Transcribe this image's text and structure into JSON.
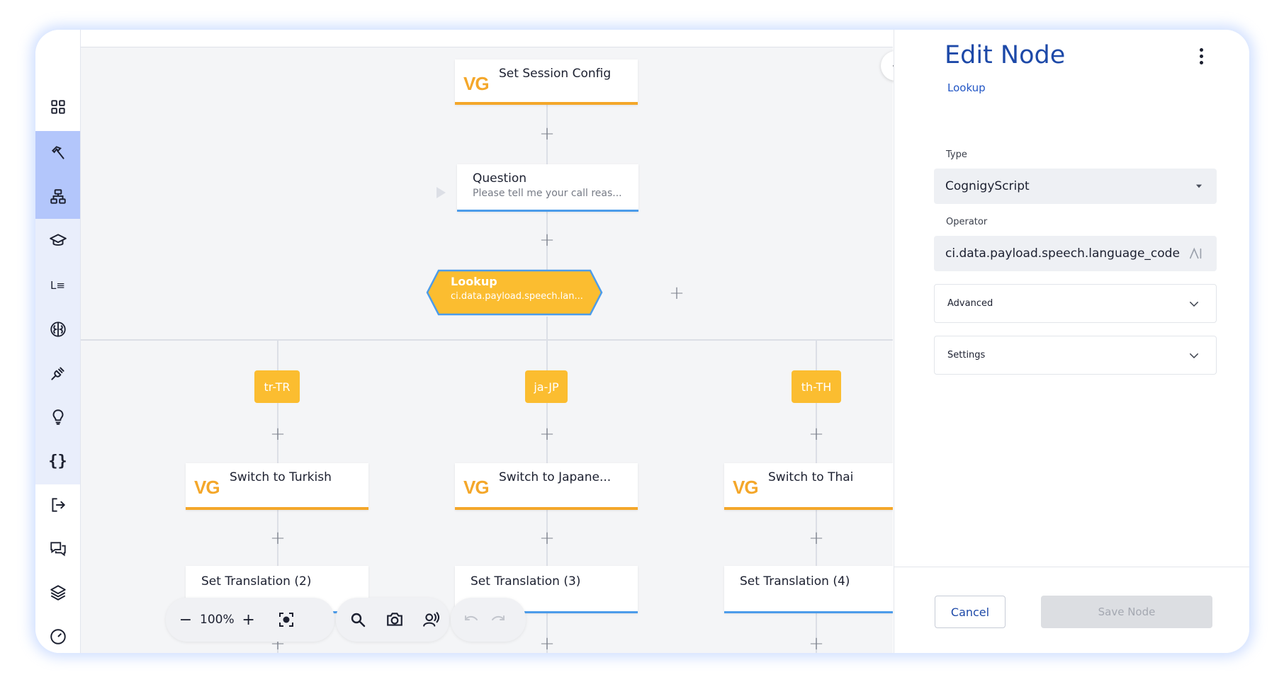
{
  "sidebar": {
    "items": [
      {
        "icon": "grid-icon"
      },
      {
        "icon": "hammer-icon"
      },
      {
        "icon": "flow-icon"
      },
      {
        "icon": "graduation-cap-icon"
      },
      {
        "icon": "lexicon-icon",
        "glyph": "L≡"
      },
      {
        "icon": "brain-icon"
      },
      {
        "icon": "plug-icon"
      },
      {
        "icon": "lightbulb-icon"
      },
      {
        "icon": "code-braces-icon",
        "glyph": "{}"
      },
      {
        "icon": "logout-icon"
      },
      {
        "icon": "chat-icon"
      },
      {
        "icon": "layers-icon"
      },
      {
        "icon": "gauge-icon"
      }
    ]
  },
  "canvas": {
    "nodes": {
      "session_config": {
        "logo": "VG",
        "title": "Set Session Config"
      },
      "question": {
        "title": "Question",
        "subtitle": "Please tell me your call reas..."
      },
      "lookup": {
        "title": "Lookup",
        "subtitle": "ci.data.payload.speech.lan..."
      },
      "case_tr": {
        "label": "tr-TR"
      },
      "case_ja": {
        "label": "ja-JP"
      },
      "case_th": {
        "label": "th-TH"
      },
      "switch_tr": {
        "logo": "VG",
        "title": "Switch to Turkish"
      },
      "switch_ja": {
        "logo": "VG",
        "title": "Switch to Japane..."
      },
      "switch_th": {
        "logo": "VG",
        "title": "Switch to Thai"
      },
      "translation_2": {
        "title": "Set Translation (2)"
      },
      "translation_3": {
        "title": "Set Translation (3)"
      },
      "translation_4": {
        "title": "Set Translation (4)"
      }
    },
    "add_glyph": "+",
    "toolbar": {
      "zoom_out": "−",
      "zoom_level": "100%",
      "zoom_in": "+"
    },
    "colors": {
      "say_node_accent": "#f4a72a",
      "blue_node_accent": "#4c9cea",
      "case_tag": "#fbbd30",
      "lookup_fill": "#fbbd30"
    }
  },
  "panel": {
    "title": "Edit Node",
    "subtitle": "Lookup",
    "type_label": "Type",
    "type_value": "CognigyScript",
    "operator_label": "Operator",
    "operator_value": "ci.data.payload.speech.language_code",
    "advanced_label": "Advanced",
    "settings_label": "Settings",
    "cancel_label": "Cancel",
    "save_label": "Save Node",
    "colors": {
      "title": "#1d49a8",
      "save_disabled_bg": "#dcdee2"
    }
  }
}
